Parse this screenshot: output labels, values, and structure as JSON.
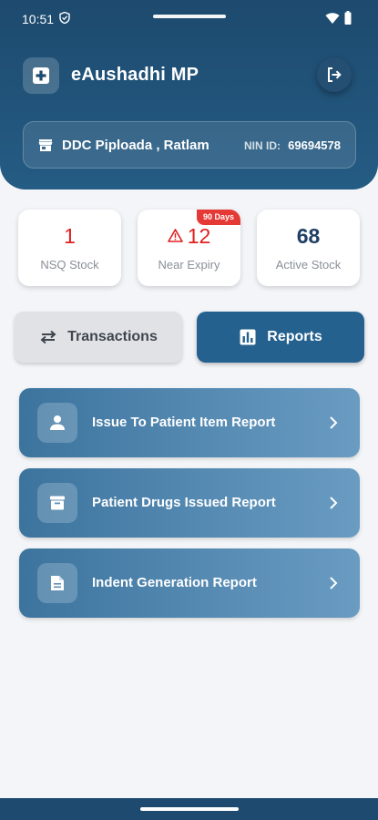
{
  "status_bar": {
    "time": "10:51",
    "icons": [
      "vpn-shield-icon",
      "wifi-icon",
      "battery-icon"
    ]
  },
  "header": {
    "app_title": "eAushadhi MP",
    "logo_icon": "medical-plus-icon",
    "logout_icon": "logout-icon",
    "location_name": "DDC Piploada , Ratlam",
    "location_icon": "store-icon",
    "nin_label": "NIN ID:",
    "nin_value": "69694578"
  },
  "stats": [
    {
      "value": "1",
      "label": "NSQ Stock",
      "color": "#e02020"
    },
    {
      "value": "12",
      "label": "Near Expiry",
      "badge": "90 Days",
      "icon": "warning-icon",
      "color": "#e02020"
    },
    {
      "value": "68",
      "label": "Active Stock",
      "color": "#1f3f64"
    }
  ],
  "tabs": {
    "transactions": {
      "label": "Transactions",
      "icon": "swap-arrows-icon",
      "active": false
    },
    "reports": {
      "label": "Reports",
      "icon": "bar-chart-icon",
      "active": true
    }
  },
  "reports": [
    {
      "label": "Issue To Patient Item Report",
      "icon": "person-icon"
    },
    {
      "label": "Patient Drugs Issued Report",
      "icon": "archive-box-icon"
    },
    {
      "label": "Indent Generation Report",
      "icon": "document-icon"
    }
  ],
  "colors": {
    "header_bg": "#1d4a6e",
    "accent": "#24618e",
    "danger": "#e53935",
    "page_bg": "#f3f5f8"
  }
}
